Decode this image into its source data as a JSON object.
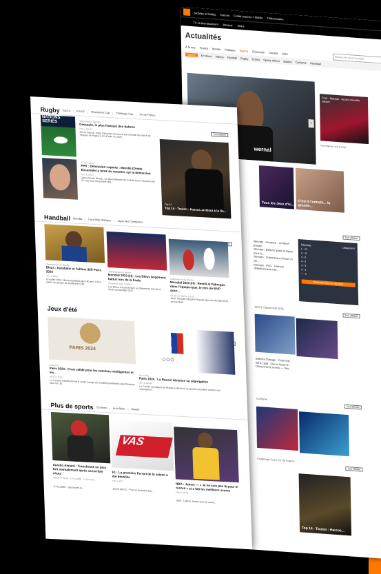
{
  "colors": {
    "accent": "#ff7900",
    "dark": "#000000"
  },
  "back_page": {
    "topbar": [
      "Mobiles et forfaits",
      "Internet",
      "Forfait Internet + Mobile",
      "Téléconnaitre",
      "TV et divertissement",
      "Banque",
      "Aides"
    ],
    "title": "Actualités",
    "subtabs": [
      "À la une",
      "France",
      "Monde",
      "Politique",
      "Sports",
      "Économie",
      "Société",
      "Auto",
      "Météo"
    ],
    "active_subtab": "Sports",
    "search_placeholder": "Rechercher dans l'actualité",
    "categories": [
      "Sports",
      "En direct",
      "Vidéos",
      "Football",
      "Rugby",
      "Tennis",
      "Sports d'hiver",
      "Basket",
      "Cyclisme",
      "Autre Moto",
      "Handball",
      "Autres"
    ],
    "hero_caption": "wernal",
    "side_ad_text": "Fruit · Marque · Accès nouvelle saison",
    "side_link": "Nos réseaux sur le sujet",
    "tile_captions": [
      "Tous les Jeux d'hi...",
      "C'est à l'entraîn... la grande..."
    ],
    "widget": {
      "tabs": [
        "Résultats",
        "Classement"
      ],
      "button": "Retrouvez tous les résultats"
    },
    "widget_rows": [
      "1 · 12",
      "2 · 11",
      "3 · 9",
      "4 · 8",
      "5 · 6",
      "6 · 4",
      "7 · 3"
    ],
    "section_heads": [
      "WTA",
      "Classement WTA",
      "Cyclisme",
      "Challenge Cup",
      "XV de France"
    ],
    "tout_afficher": "Tout afficher",
    "list1": [
      "Mercato : Arnaut a... renforcé Brestin",
      "Mercato : Bellens quitte le Bayer pour le...",
      "Mercato : Sulemana a réussi un joli...",
      "Mercato : PSG : Hamoui définitivement mal..."
    ],
    "list2": [
      "Sabrina Outrage · Cette fois...",
      "WTA Light · Qui se hisse le...",
      "Découvrez le tennis — Ses..."
    ],
    "bottom_caption": "Top 14 · Toulon : Harcos..."
  },
  "front_page": {
    "rugby": {
      "title": "Rugby",
      "links": [
        "Top 14",
        "Pro D2",
        "Champions Cup",
        "Challenge Cup",
        "XV de France"
      ],
      "tout": "Tout afficher",
      "banner": "NATIONS SERIES",
      "article1": {
        "kicker": "Tournoi des 6 Nations",
        "headline": "Dessaule, le plus français des Italiens",
        "meta": "Hier à 16h12",
        "body": "Né en France, Ange Capuozzo se trouve sur la feuille de match de l'équipe de Rugby à XV d'Italie en 2023."
      },
      "article2": {
        "kicker": "XV de France",
        "headline": "PPR : Démission Laporte : Morelle (Droits Ensemble) a tenté de remettre sur la démission",
        "meta": "Hier à 16h27",
        "body": "Jean-Claude Skrela : Le dépouillement de la fédé donne toujours ses 25 voix pour l'ensemble des..."
      },
      "hero": {
        "kicker": "Top 14",
        "caption": "Top 14 · Toulon : Harcos arrêtera à la fin..."
      }
    },
    "handball": {
      "title": "Handball",
      "links": [
        "Mondial",
        "Liqui Moly Starligue",
        "Ligue des Champions"
      ],
      "tout": "Tout afficher",
      "items": [
        {
          "kicker": "Championnat du Monde",
          "headline": "Bleus : Karabatic et l'ultime défi Paris 2024",
          "meta": "Hier à 18h11",
          "body": "En juillet 2024, Nikola Karabatic aura 40 ans. Il fera partie du groupe de Guillaume Gille."
        },
        {
          "kicker": "Championnat du Monde",
          "headline": "Mondial 2023 (H) : Les Bleus largement battus lors de la finale",
          "meta": "29 janvier 2023 à 19h21",
          "body": "Les Bleus ont perdu face au Danemark lors de la finale du Mondial 2023."
        },
        {
          "kicker": "Championnat du Monde",
          "headline": "Mondial 2023 (H) : Remili et Fàbregas dans l'équipe-type, le titre de MVP pour...",
          "meta": "29 janvier 2023 à 17h20",
          "body": "Deux français intègrent l'équipe-type du Mondial 2023 de handball."
        }
      ]
    },
    "jeux": {
      "title": "Jeux d'été",
      "tout": "Tout afficher",
      "logo_text": "PARIS 2024",
      "items": [
        {
          "kicker": "Jeux d'été",
          "headline": "Paris 2024 : C'est validé pour les caméras intelligentes et les...",
          "meta": "Hier à 17h12",
          "body": "Le Conseil constitutionnel a validé l'usage de la vidéosurveillance algorithmique pour les JO."
        },
        {
          "kicker": "Jeux d'été",
          "headline": "Paris 2024 : La Russie dénonce sa ségrégation",
          "meta": "Hier à 18h08",
          "body": "Le Comité olympique de Russie a dénoncé ce qu'elle considère comme une ségrégation."
        }
      ]
    },
    "plus": {
      "title": "Plus de sports",
      "links": [
        "Cyclisme",
        "Auto-Moto",
        "Basket"
      ],
      "items": [
        {
          "headline": "Aurelio Aimard : Transformé en plus fort mentalement après sa terrible chute",
          "meta": "DÉCRYPTAGE · CYCLISME · Le Français...",
          "footer": "CYCLISME · Découvrez le..."
        },
        {
          "headline": "F1 : La première Ferrari de la saison a été dévoilée",
          "meta": "Hier à 12h",
          "footer": "AUTO MOTO · Pour la première fois..."
        },
        {
          "headline": "NBA : James — « Je ne suis pas là pour le record » et a fait les meilleurs scores",
          "meta": "Hier à 07h21",
          "footer": "NBA · LeBron James et la 2e survie..."
        }
      ],
      "car_text": "VAS"
    }
  }
}
